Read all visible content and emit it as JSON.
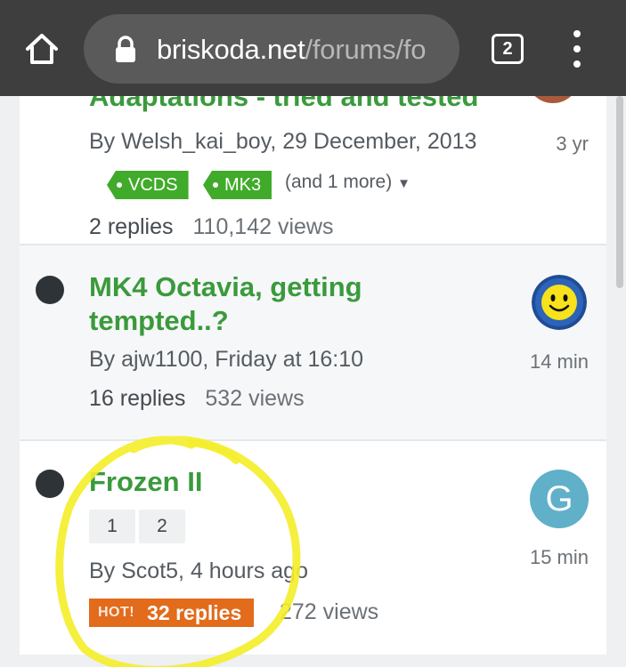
{
  "browser": {
    "url_domain": "briskoda.net",
    "url_path": "/forums/fo",
    "tab_count": "2",
    "icons": [
      "home-icon",
      "lock-icon",
      "tab-switcher-icon",
      "overflow-menu-icon"
    ]
  },
  "topics": [
    {
      "title_partial": "Adaptations - tried and tested",
      "byline": "By Welsh_kai_boy, 29 December, 2013",
      "tags": [
        "VCDS",
        "MK3"
      ],
      "more_tags": "(and 1 more)",
      "replies": "2 replies",
      "views": "110,142 views",
      "last_post": "3 yr"
    },
    {
      "title": "MK4 Octavia, getting tempted..?",
      "byline": "By ajw1100, Friday at 16:10",
      "replies": "16 replies",
      "views": "532 views",
      "last_post": "14 min",
      "avatar": "smiley-avatar"
    },
    {
      "title": "Frozen II",
      "pages": [
        "1",
        "2"
      ],
      "byline": "By Scot5, 4 hours ago",
      "hot_label": "HOT!",
      "replies": "32 replies",
      "views": "272 views",
      "last_post": "15 min",
      "avatar_letter": "G"
    }
  ],
  "colors": {
    "chrome_bg": "#3e3e3e",
    "title_green": "#3a9a3c",
    "tag_green": "#40ab2a",
    "hot_orange": "#e26b1c",
    "annotation_yellow": "#f4ee2c"
  }
}
